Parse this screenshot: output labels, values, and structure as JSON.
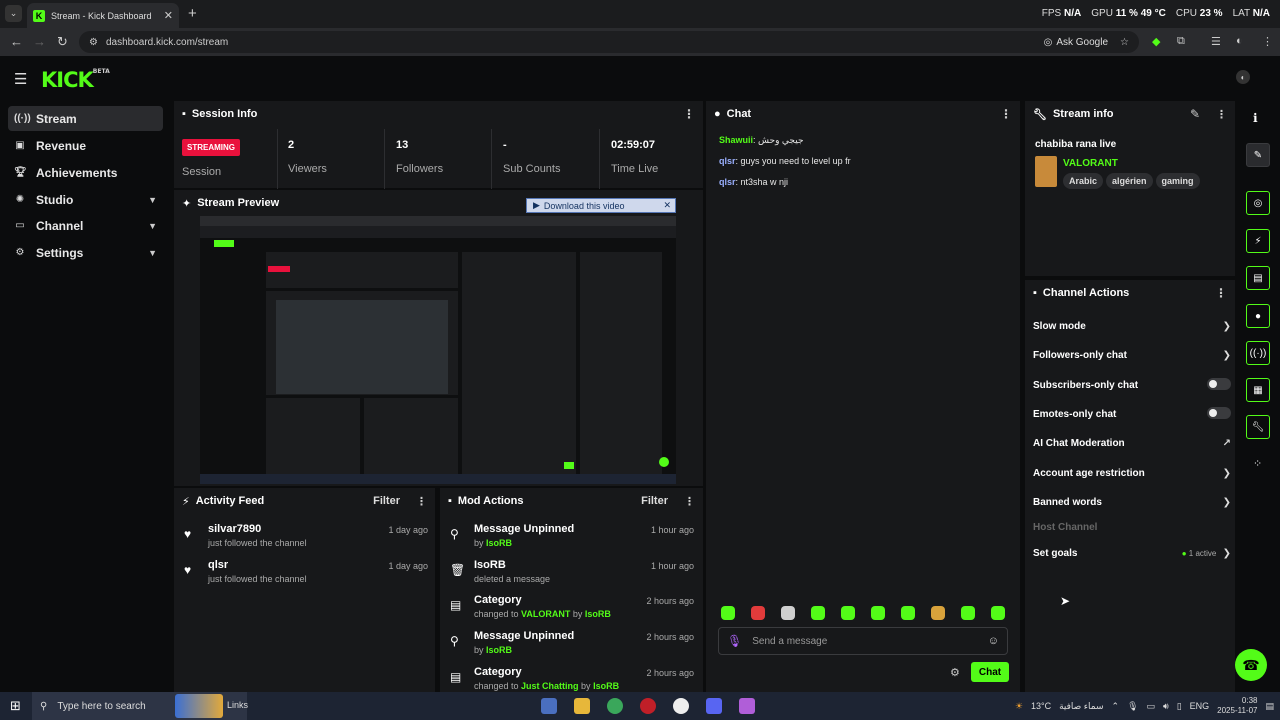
{
  "browser": {
    "tab_title": "Stream - Kick Dashboard",
    "url": "dashboard.kick.com/stream",
    "ask_google": "Ask Google",
    "stats": [
      {
        "label": "FPS",
        "value": "N/A"
      },
      {
        "label": "GPU",
        "value": "11 %  49 °C"
      },
      {
        "label": "CPU",
        "value": "23 %"
      },
      {
        "label": "LAT",
        "value": "N/A"
      }
    ]
  },
  "logo": {
    "text": "KICK",
    "sup": "BETA"
  },
  "sidebar": {
    "items": [
      {
        "label": "Stream",
        "icon": "broadcast-icon"
      },
      {
        "label": "Revenue",
        "icon": "revenue-icon"
      },
      {
        "label": "Achievements",
        "icon": "trophy-icon"
      },
      {
        "label": "Studio",
        "icon": "studio-icon"
      },
      {
        "label": "Channel",
        "icon": "channel-icon"
      },
      {
        "label": "Settings",
        "icon": "gear-icon"
      }
    ]
  },
  "session": {
    "title": "Session Info",
    "badge": "STREAMING",
    "stats": [
      {
        "value": "",
        "label": "Session"
      },
      {
        "value": "2",
        "label": "Viewers"
      },
      {
        "value": "13",
        "label": "Followers"
      },
      {
        "value": "-",
        "label": "Sub Counts"
      },
      {
        "value": "02:59:07",
        "label": "Time Live"
      }
    ]
  },
  "preview": {
    "title": "Stream Preview",
    "download": "Download this video"
  },
  "activity": {
    "title": "Activity Feed",
    "filter": "Filter",
    "items": [
      {
        "user": "silvar7890",
        "text": "just followed the channel",
        "ago": "1 day ago"
      },
      {
        "user": "qlsr",
        "text": "just followed the channel",
        "ago": "1 day ago"
      }
    ]
  },
  "mod": {
    "title": "Mod Actions",
    "filter": "Filter",
    "items": [
      {
        "title": "Message Unpinned",
        "pre": "by ",
        "hl": "IsoRB",
        "mid": "",
        "hl2": "",
        "ago": "1 hour ago"
      },
      {
        "title": "IsoRB",
        "pre": "deleted a message",
        "hl": "",
        "mid": "",
        "hl2": "",
        "ago": "1 hour ago"
      },
      {
        "title": "Category",
        "pre": "changed to ",
        "hl": "VALORANT",
        "mid": " by ",
        "hl2": "IsoRB",
        "ago": "2 hours ago"
      },
      {
        "title": "Message Unpinned",
        "pre": "by ",
        "hl": "IsoRB",
        "mid": "",
        "hl2": "",
        "ago": "2 hours ago"
      },
      {
        "title": "Category",
        "pre": "changed to ",
        "hl": "Just Chatting",
        "mid": " by ",
        "hl2": "IsoRB",
        "ago": "2 hours ago"
      }
    ]
  },
  "chat": {
    "title": "Chat",
    "messages": [
      {
        "user": "Shawuii",
        "text": "جيجي وحش"
      },
      {
        "user": "qlsr",
        "text": "guys you need to level up fr"
      },
      {
        "user": "qlsr",
        "text": "nt3sha w nji"
      }
    ],
    "placeholder": "Send a message",
    "send": "Chat"
  },
  "stream_info": {
    "title": "Stream info",
    "stream_title": "chabiba rana live",
    "category": "VALORANT",
    "tags": [
      "Arabic",
      "algérien",
      "gaming"
    ]
  },
  "channel_actions": {
    "title": "Channel Actions",
    "items": [
      {
        "label": "Slow mode",
        "control": "chevron"
      },
      {
        "label": "Followers-only chat",
        "control": "chevron"
      },
      {
        "label": "Subscribers-only chat",
        "control": "toggle"
      },
      {
        "label": "Emotes-only chat",
        "control": "toggle"
      },
      {
        "label": "AI Chat Moderation",
        "control": "external"
      },
      {
        "label": "Account age restriction",
        "control": "chevron"
      },
      {
        "label": "Banned words",
        "control": "chevron"
      },
      {
        "label": "Host Channel",
        "control": "none"
      },
      {
        "label": "Set goals",
        "control": "goals"
      }
    ],
    "goals_active": "1 active"
  },
  "taskbar": {
    "search": "Type here to search",
    "links": "Links",
    "weather": "13°C",
    "weather_text": "سماء صافية",
    "lang": "ENG",
    "time": "0:38",
    "date": "2025-11-07"
  },
  "colors": {
    "accent": "#53fc18",
    "streaming": "#e9113c"
  }
}
